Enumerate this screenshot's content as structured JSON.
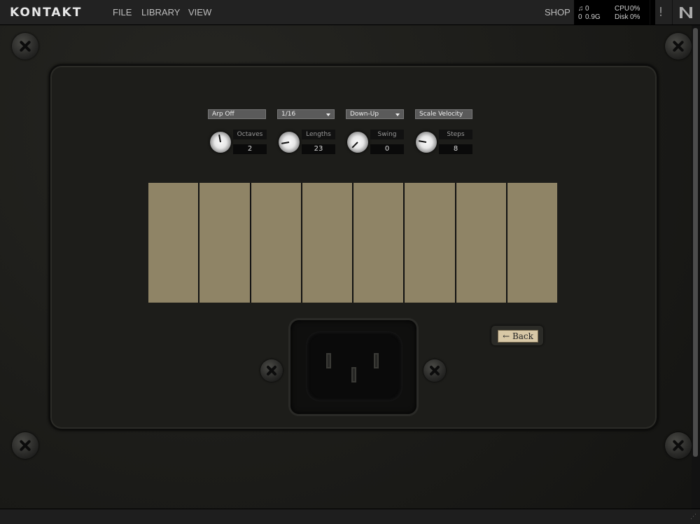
{
  "app": {
    "logo": "KONTAKT",
    "menu": [
      "FILE",
      "LIBRARY",
      "VIEW"
    ],
    "shop": "SHOP",
    "stats": {
      "midi_icon": "midi-icon",
      "midi_value": "0",
      "voices_value": "0",
      "memory": "0.9G",
      "cpu_label": "CPU",
      "cpu_value": "0%",
      "disk_label": "Disk",
      "disk_value": "0%"
    },
    "warning": "!",
    "ni_logo": "N"
  },
  "arp": {
    "dropdowns": [
      "Arp Off",
      "1/16",
      "Down-Up",
      "Scale Velocity"
    ],
    "knobs": [
      {
        "label": "Octaves",
        "value": "2",
        "angle": -10
      },
      {
        "label": "Lengths",
        "value": "23",
        "angle": -100
      },
      {
        "label": "Swing",
        "value": "0",
        "angle": -135
      },
      {
        "label": "Steps",
        "value": "8",
        "angle": -80
      }
    ],
    "steps": {
      "count": 8,
      "color": "#8f8466"
    }
  },
  "back_button": "← Back",
  "colors": {
    "panel": "#1c1c19",
    "step": "#8f8466",
    "button": "#d8c8a6"
  }
}
